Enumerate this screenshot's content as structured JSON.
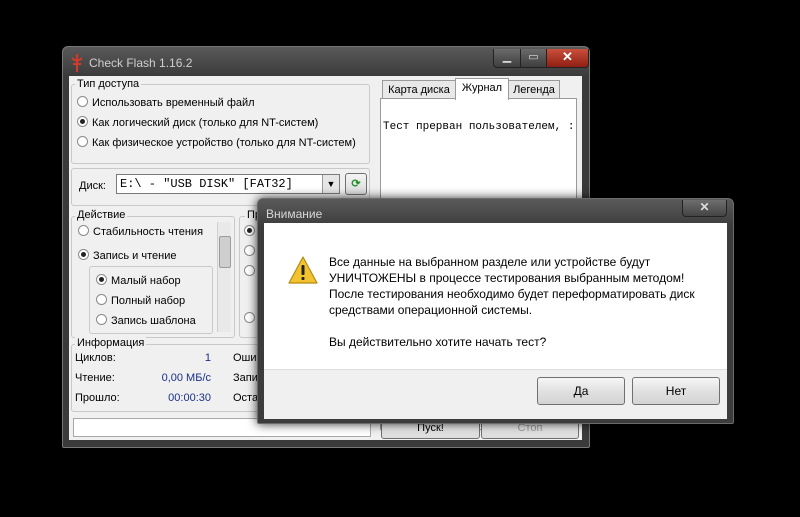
{
  "main_window": {
    "title": "Check Flash 1.16.2",
    "access_group": {
      "label": "Тип доступа",
      "options": [
        {
          "label": "Использовать временный файл",
          "selected": false
        },
        {
          "label": "Как логический диск (только для NT-систем)",
          "selected": true
        },
        {
          "label": "Как физическое устройство (только для NT-систем)",
          "selected": false
        }
      ]
    },
    "disk": {
      "label": "Диск:",
      "value": "E:\\ - \"USB DISK\" [FAT32]"
    },
    "action_group": {
      "label": "Действие",
      "options": [
        {
          "label": "Стабильность чтения",
          "selected": false
        },
        {
          "label": "Запись и чтение",
          "selected": true
        }
      ],
      "sub_options": [
        {
          "label": "Малый набор",
          "selected": true
        },
        {
          "label": "Полный набор",
          "selected": false
        },
        {
          "label": "Запись шаблона",
          "selected": false
        }
      ]
    },
    "duration_group": {
      "label": "Пр"
    },
    "info_group": {
      "label": "Информация",
      "rows": [
        {
          "label": "Циклов:",
          "value": "1",
          "right_label": "Ошиб"
        },
        {
          "label": "Чтение:",
          "value": "0,00 МБ/с",
          "right_label": "Запис"
        },
        {
          "label": "Прошло:",
          "value": "00:00:30",
          "right_label": "Остал"
        }
      ]
    },
    "tabs": [
      {
        "label": "Карта диска",
        "active": false
      },
      {
        "label": "Журнал",
        "active": true
      },
      {
        "label": "Легенда",
        "active": false
      }
    ],
    "log_text": "Тест прерван пользователем, :",
    "start_button": "Пуск!",
    "stop_button": "Стоп"
  },
  "dialog": {
    "title": "Внимание",
    "icon": "warning-icon",
    "message_lines": [
      "Все данные на выбранном разделе или устройстве будут",
      "УНИЧТОЖЕНЫ в процессе тестирования выбранным методом!",
      "После тестирования необходимо будет переформатировать диск",
      "средствами операционной системы.",
      "",
      "Вы действительно хотите начать тест?"
    ],
    "yes_button": "Да",
    "no_button": "Нет"
  },
  "colors": {
    "accent_red": "#c0392b",
    "value_blue": "#1a2f8a",
    "warning_yellow": "#f2c230"
  }
}
